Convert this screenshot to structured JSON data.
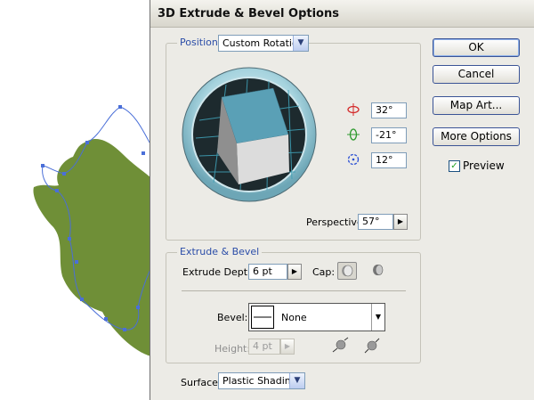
{
  "dialog": {
    "title": "3D Extrude & Bevel Options"
  },
  "position": {
    "legend": "Position:",
    "preset": "Custom Rotation",
    "x_rotation": "32°",
    "y_rotation": "-21°",
    "z_rotation": "12°",
    "perspective_label": "Perspective:",
    "perspective_value": "57°"
  },
  "extrude": {
    "legend": "Extrude & Bevel",
    "depth_label": "Extrude Depth:",
    "depth_value": "6 pt",
    "cap_label": "Cap:",
    "bevel_label": "Bevel:",
    "bevel_value": "None",
    "height_label": "Height:",
    "height_value": "4 pt"
  },
  "surface": {
    "label": "Surface:",
    "value": "Plastic Shading"
  },
  "buttons": {
    "ok": "OK",
    "cancel": "Cancel",
    "map_art": "Map Art...",
    "more_options": "More Options",
    "preview_label": "Preview",
    "preview_checked": true
  },
  "colors": {
    "artwork_fill": "#6f8f37",
    "path_stroke": "#4a6fd8",
    "cube_top": "#5aa0b6",
    "legend_text": "#2b4da8"
  },
  "icons": {
    "x_axis": "rotate-x-icon",
    "y_axis": "rotate-y-icon",
    "z_axis": "rotate-z-icon",
    "cap_on": "cap-on-icon",
    "cap_off": "cap-off-icon",
    "bevel_out": "bevel-out-icon",
    "bevel_in": "bevel-in-icon"
  }
}
